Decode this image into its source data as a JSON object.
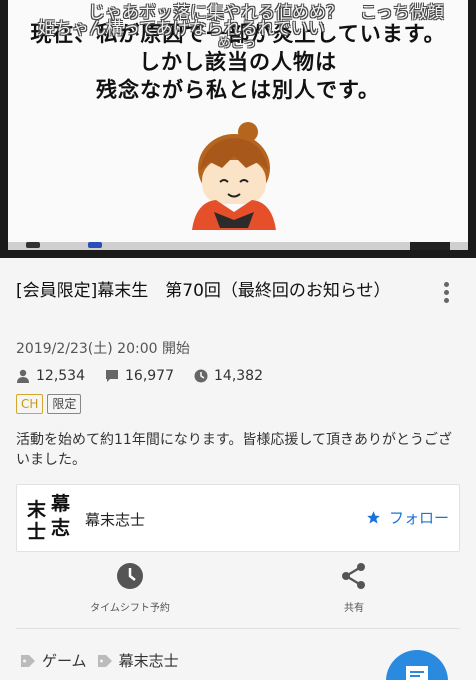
{
  "player": {
    "comments": [
      "じゃあボッ落に集やれる値めめ？　こっち微顔",
      "姫ちゃん構ってあげなられるれでいい",
      "めこっ"
    ],
    "slide_text": [
      "現在、私が原因で一部が炎上しています。",
      "しかし該当の人物は",
      "残念ながら私とは別人です。"
    ]
  },
  "program": {
    "title": "[会員限定]幕末生　第70回（最終回のお知らせ）",
    "date": "2019/2/23(土) 20:00 開始",
    "viewers": "12,534",
    "comments": "16,977",
    "timeshift_count": "14,382",
    "badges": {
      "ch": "CH",
      "limited": "限定"
    },
    "description": "活動を始めて約11年間になります。皆様応援して頂きありがとうございました。"
  },
  "channel": {
    "logo_chars": [
      "幕",
      "末",
      "志",
      "士"
    ],
    "name": "幕末志士",
    "follow_label": "フォロー"
  },
  "actions": {
    "timeshift_label": "タイムシフト予約",
    "share_label": "共有"
  },
  "tags": [
    "ゲーム",
    "幕末志士"
  ],
  "colors": {
    "accent": "#1a73d9",
    "fab": "#2a8ae0",
    "ch_badge": "#d4a72c"
  },
  "icons": {
    "viewers": "person-icon",
    "comments": "comment-icon",
    "timeshift": "clock-icon",
    "share": "share-icon",
    "follow": "star-icon",
    "tag": "tag-icon",
    "menu": "more-vert-icon",
    "fab": "comment-compose-icon"
  }
}
